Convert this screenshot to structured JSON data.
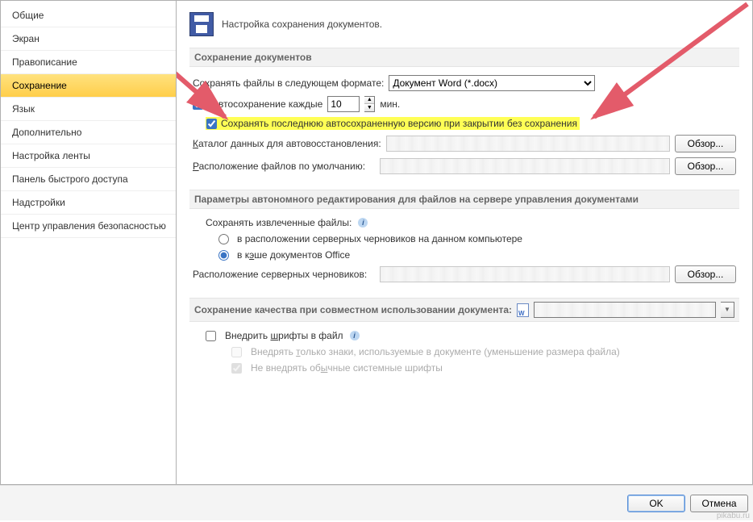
{
  "sidebar": {
    "items": [
      {
        "label": "Общие"
      },
      {
        "label": "Экран"
      },
      {
        "label": "Правописание"
      },
      {
        "label": "Сохранение"
      },
      {
        "label": "Язык"
      },
      {
        "label": "Дополнительно"
      },
      {
        "label": "Настройка ленты"
      },
      {
        "label": "Панель быстрого доступа"
      },
      {
        "label": "Надстройки"
      },
      {
        "label": "Центр управления безопасностью"
      }
    ],
    "activeIndex": 3
  },
  "header": {
    "title": "Настройка сохранения документов."
  },
  "section1": {
    "title": "Сохранение документов",
    "saveFormatLabel": "Сохранять файлы в следующем формате:",
    "saveFormatValue": "Документ Word (*.docx)",
    "autosaveLabel": "Автосохранение каждые",
    "autosaveValue": "10",
    "autosaveUnit": "мин.",
    "keepLastLabel": "Сохранять последнюю автосохраненную версию при закрытии без сохранения",
    "folderLabel": "Каталог данных для автовосстановления:",
    "defaultLocLabel": "Расположение файлов по умолчанию:",
    "browse": "Обзор..."
  },
  "section2": {
    "title": "Параметры автономного редактирования для файлов на сервере управления документами",
    "saveExtractedLabel": "Сохранять извлеченные файлы:",
    "opt1": "в расположении серверных черновиков на данном компьютере",
    "opt2": "в кэше документов Office",
    "draftsLabel": "Расположение серверных черновиков:",
    "browse": "Обзор..."
  },
  "section3": {
    "title": "Сохранение качества при совместном использовании документа:",
    "embedLabel": "Внедрить шрифты в файл",
    "sub1": "Внедрять только знаки, используемые в документе (уменьшение размера файла)",
    "sub2": "Не внедрять обычные системные шрифты"
  },
  "footer": {
    "ok": "OK",
    "cancel": "Отмена"
  },
  "watermark": "pikabu.ru"
}
